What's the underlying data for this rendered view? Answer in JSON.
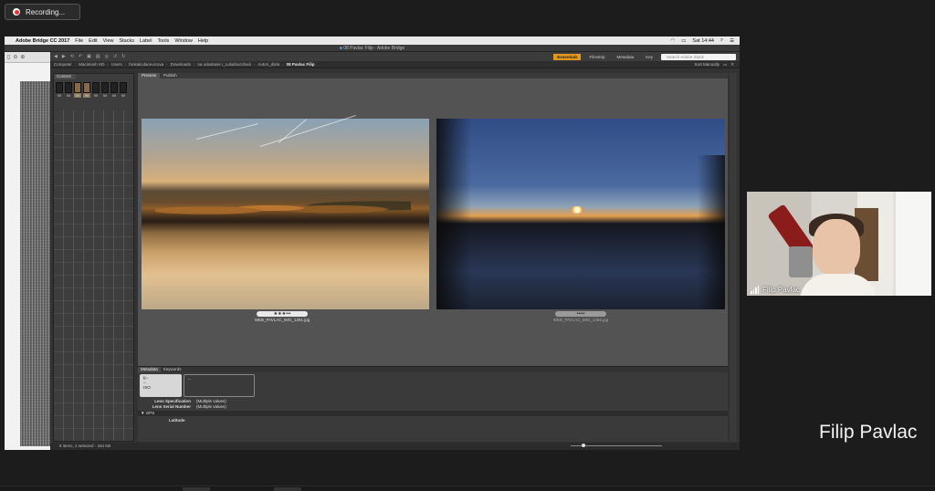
{
  "recording": {
    "label": "Recording..."
  },
  "mac_menubar": {
    "app": "Adobe Bridge CC 2017",
    "items": [
      "File",
      "Edit",
      "View",
      "Stacks",
      "Label",
      "Tools",
      "Window",
      "Help"
    ],
    "clock": "Sat 14:44"
  },
  "window_title": "08 Pavlac Filip - Adobe Bridge",
  "workspaces": [
    "Essentials",
    "Filmstrip",
    "Metadata",
    "Key"
  ],
  "search": {
    "placeholder": "Search Adobe Stock"
  },
  "breadcrumb": [
    "Computer",
    "Macintosh HD",
    "Users",
    "fonkalicdacevicova",
    "Downloads",
    "na odoslanie i_LukašovÚlová",
    "Autori_diela",
    "08 Pavlac Filip"
  ],
  "sort": {
    "label": "Sort Manually"
  },
  "left_panel": {
    "tab": "Content",
    "thumbs": [
      "W",
      "W",
      "W",
      "W",
      "W",
      "W",
      "W",
      "W",
      "W",
      "W"
    ]
  },
  "main_tabs": [
    "Preview",
    "Publish"
  ],
  "photos": [
    {
      "filename": "WEB_PAVLAC_IMG_1261.jpg",
      "rating": "★★★•••"
    },
    {
      "filename": "WEB_PAVLAC_IMG_1456.jpg",
      "rating": "•••••"
    }
  ],
  "metadata": {
    "tabs": [
      "Metadata",
      "Keywords"
    ],
    "exif": {
      "aperture": "f/--",
      "shutter": "--",
      "iso": "ISO",
      "extra": "--"
    },
    "rows": [
      {
        "key": "Lens Specification",
        "value": "(Multiple values)"
      },
      {
        "key": "Lens Serial Number",
        "value": "(Multiple values)"
      }
    ],
    "section": "GPS",
    "latitude_label": "Latitude"
  },
  "status_bar": {
    "text": "8 items, 2 selected - 334 KB"
  },
  "webcam": {
    "participant": "Filip Pavlac"
  },
  "speaker_name": "Filip Pavlac",
  "colors": {
    "essentials_accent": "#e39a1c",
    "recording_dot": "#dd3333"
  }
}
